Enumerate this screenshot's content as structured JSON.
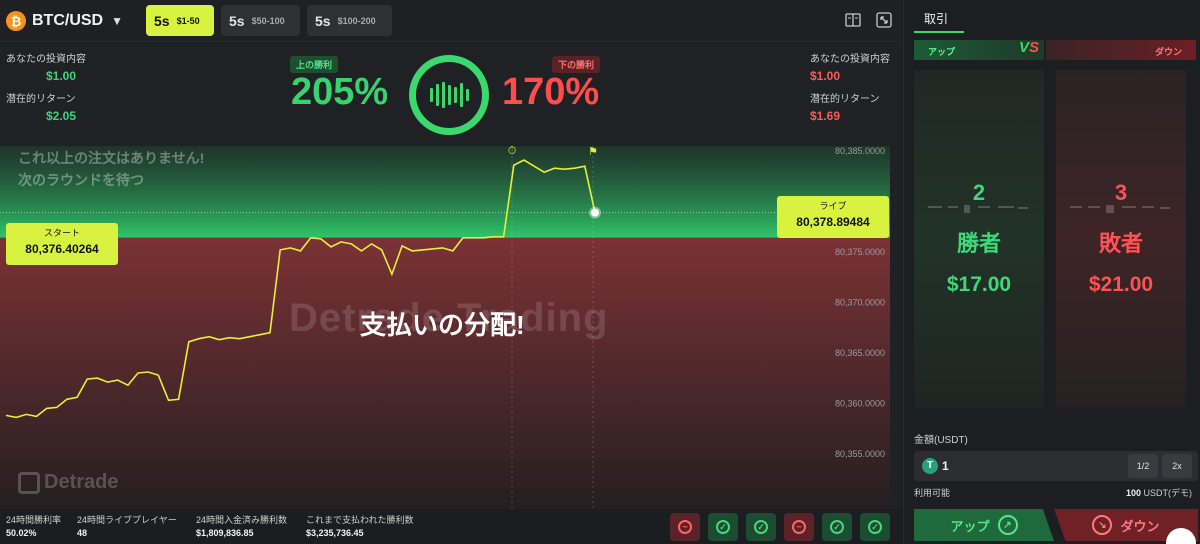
{
  "header": {
    "pair": "BTC/USD",
    "btc_icon": "₿",
    "timeframes": [
      {
        "sec": "5s",
        "range": "$1-50"
      },
      {
        "sec": "5s",
        "range": "$50-100"
      },
      {
        "sec": "5s",
        "range": "$100-200"
      }
    ]
  },
  "left_stats": {
    "invest_label": "あなたの投資内容",
    "invest_value": "$1.00",
    "return_label": "潜在的リターン",
    "return_value": "$2.05"
  },
  "right_stats": {
    "invest_label": "あなたの投資内容",
    "invest_value": "$1.00",
    "return_label": "潜在的リターン",
    "return_value": "$1.69"
  },
  "odds": {
    "up_label": "上の勝利",
    "up_pct": "205%",
    "down_label": "下の勝利",
    "down_pct": "170%"
  },
  "chart": {
    "no_more_line1": "これ以上の注文はありません!",
    "no_more_line2": "次のラウンドを待つ",
    "watermark": "Detrade Trading",
    "payout_message": "支払いの分配!",
    "logo": "Detrade",
    "start_label": "スタート",
    "start_value": "80,376.40264",
    "live_label": "ライブ",
    "live_value": "80,378.89484",
    "y_ticks": [
      "80,385.0000",
      "80,380.0000",
      "80,375.0000",
      "80,370.0000",
      "80,365.0000",
      "80,360.0000",
      "80,355.0000"
    ]
  },
  "chart_data": {
    "type": "line",
    "ylim": [
      80352.5,
      80385.5
    ],
    "y_ticks": [
      80385,
      80380,
      80375,
      80370,
      80365,
      80360,
      80355
    ],
    "start_price": 80376.40264,
    "live_price": 80378.89484,
    "series": [
      {
        "values": [
          80358.8,
          80358.6,
          80358.9,
          80358.7,
          80359.5,
          80359.6,
          80360.4,
          80360.6,
          80362.4,
          80362.5,
          80362.1,
          80362.3,
          80361.8,
          80363.0,
          80363.1,
          80362.8,
          80360.3,
          80360.4,
          80366.1,
          80366.4,
          80366.6,
          80366.3,
          80366.5,
          80366.4,
          80366.6,
          80366.8,
          80367.0,
          80375.2,
          80375.4,
          80375.1,
          80376.4,
          80376.3,
          80375.5,
          80376.0,
          80375.8,
          80375.1,
          80375.8,
          80375.2,
          80372.8,
          80375.6,
          80375.1,
          80375.2,
          80375.3,
          80375.4,
          80375.1,
          80376.4,
          80376.4,
          80376.4,
          80376.5,
          80376.5,
          80383.6,
          80384.1,
          80383.5,
          80382.9,
          80383.3,
          80383.2,
          80383.3,
          80383.5,
          80378.9
        ]
      }
    ]
  },
  "footer": {
    "stats": [
      {
        "label": "24時間勝利率",
        "value": "50.02%"
      },
      {
        "label": "24時間ライブプレイヤー",
        "value": "48"
      },
      {
        "label": "24時間入金済み勝利数",
        "value": "$1,809,836.85"
      },
      {
        "label": "これまで支払われた勝利数",
        "value": "$3,235,736.45"
      }
    ],
    "history": [
      "down",
      "up",
      "up",
      "down",
      "up",
      "up"
    ]
  },
  "panel": {
    "tab": "取引",
    "vs_up": "アップ",
    "vs_down": "ダウン",
    "vs_v": "V",
    "vs_s": "S",
    "winners_count": "2",
    "winners_label": "勝者",
    "winners_amount": "$17.00",
    "losers_count": "3",
    "losers_label": "敗者",
    "losers_amount": "$21.00",
    "amount_label": "金額(USDT)",
    "amount_value": "1",
    "half_label": "1/2",
    "double_label": "2x",
    "available_label": "利用可能",
    "available_amount": "100",
    "available_unit": "USDT(デモ)",
    "up_button": "アップ",
    "down_button": "ダウン"
  },
  "colors": {
    "accent": "#d7f33f",
    "up": "#3ad86d",
    "down": "#ff4d4d"
  }
}
